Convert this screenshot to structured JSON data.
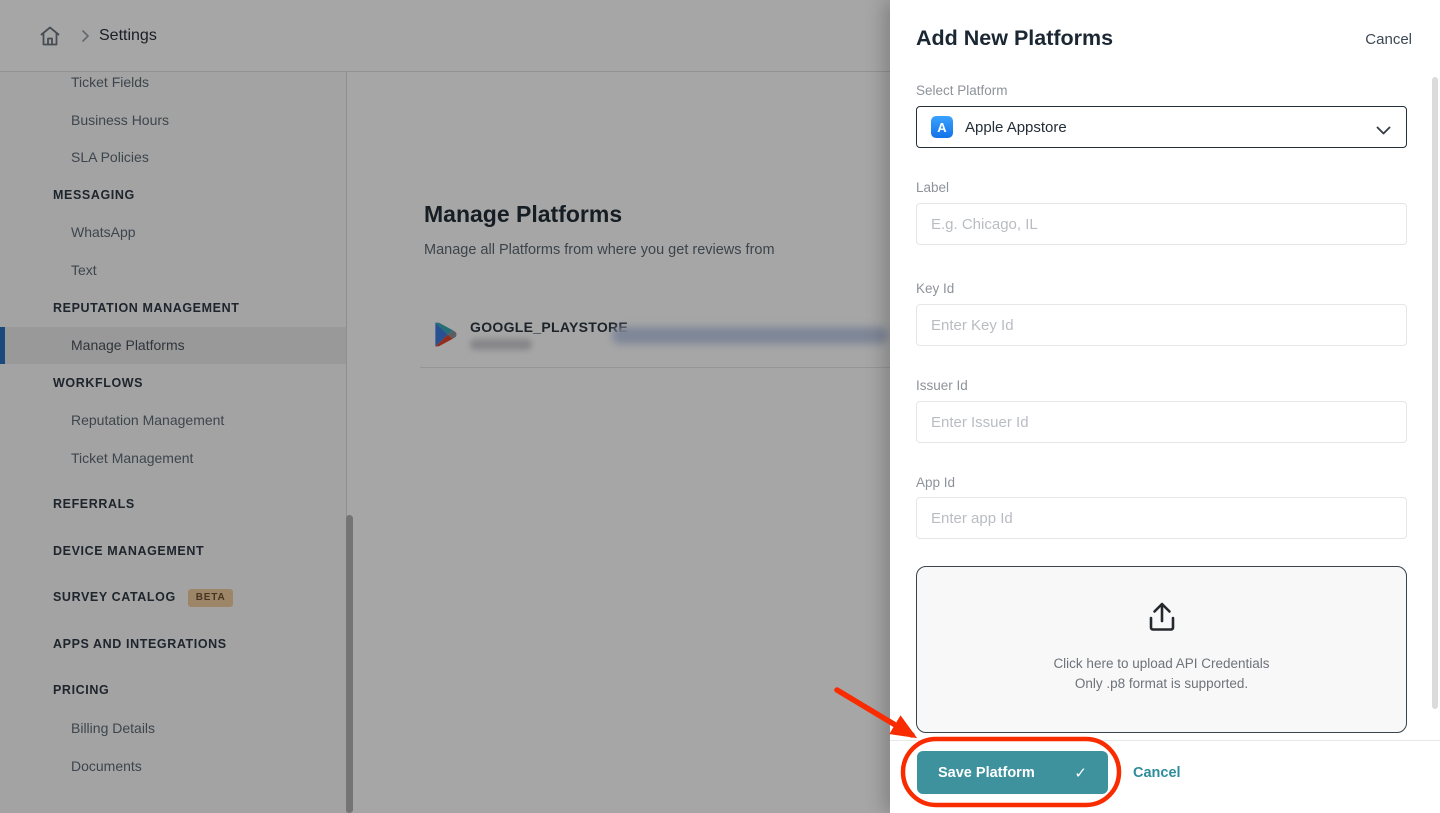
{
  "breadcrumb": {
    "home_icon": "home-icon",
    "separator_icon": "chevron-right-icon",
    "current": "Settings"
  },
  "sidebar": {
    "items": [
      {
        "type": "item",
        "label": "Ticket Fields"
      },
      {
        "type": "item",
        "label": "Business Hours"
      },
      {
        "type": "item",
        "label": "SLA Policies"
      },
      {
        "type": "section",
        "label": "MESSAGING"
      },
      {
        "type": "item",
        "label": "WhatsApp"
      },
      {
        "type": "item",
        "label": "Text"
      },
      {
        "type": "section",
        "label": "REPUTATION MANAGEMENT"
      },
      {
        "type": "item",
        "label": "Manage Platforms",
        "selected": true
      },
      {
        "type": "section",
        "label": "WORKFLOWS"
      },
      {
        "type": "item",
        "label": "Reputation Management"
      },
      {
        "type": "item",
        "label": "Ticket Management"
      },
      {
        "type": "section",
        "label": "REFERRALS"
      },
      {
        "type": "section",
        "label": "DEVICE MANAGEMENT"
      },
      {
        "type": "section",
        "label": "SURVEY CATALOG",
        "badge": "BETA"
      },
      {
        "type": "section",
        "label": "APPS AND INTEGRATIONS"
      },
      {
        "type": "section",
        "label": "PRICING"
      },
      {
        "type": "item",
        "label": "Billing Details"
      },
      {
        "type": "item",
        "label": "Documents"
      }
    ]
  },
  "main": {
    "title": "Manage Platforms",
    "subtitle": "Manage all Platforms from where you get reviews from",
    "platforms": [
      {
        "name": "GOOGLE_PLAYSTORE",
        "icon": "google-play-icon",
        "url_text": "redacted-blurred",
        "subtext": "redacted-blurred"
      }
    ]
  },
  "drawer": {
    "title": "Add New Platforms",
    "cancel_label": "Cancel",
    "select_platform": {
      "label": "Select Platform",
      "value": "Apple Appstore",
      "icon": "apple-appstore-icon",
      "chevron_icon": "chevron-down-icon"
    },
    "fields": {
      "label": {
        "label": "Label",
        "placeholder": "E.g. Chicago, IL",
        "value": ""
      },
      "key_id": {
        "label": "Key Id",
        "placeholder": "Enter Key Id",
        "value": ""
      },
      "issuer_id": {
        "label": "Issuer Id",
        "placeholder": "Enter Issuer Id",
        "value": ""
      },
      "app_id": {
        "label": "App Id",
        "placeholder": "Enter app Id",
        "value": ""
      }
    },
    "upload": {
      "icon": "upload-icon",
      "line1": "Click here to upload API Credentials",
      "line2": "Only .p8 format is supported."
    },
    "footer": {
      "save_label": "Save Platform",
      "save_check": "✓",
      "cancel_label": "Cancel"
    }
  },
  "colors": {
    "accent_teal": "#3d929e",
    "footer_cancel_teal": "#2e8d9b",
    "annotation_red": "#f92c00",
    "selected_item_blue": "#2a70c2",
    "beta_badge_bg": "#f2cda0",
    "appstore_icon_blue": "#1f85f2"
  }
}
